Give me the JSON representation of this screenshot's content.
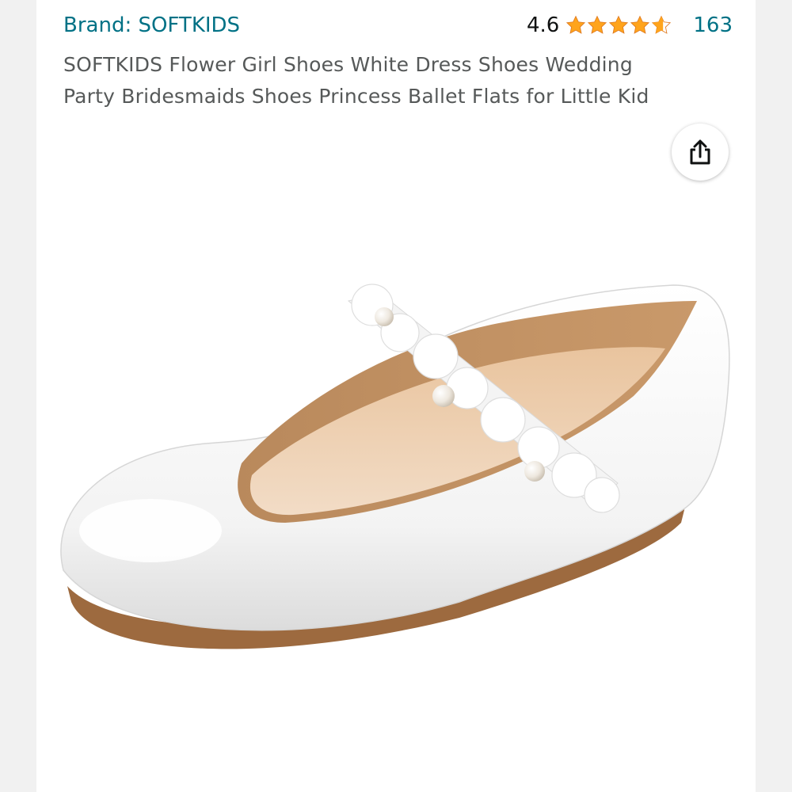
{
  "product": {
    "brand_link": "Brand: SOFTKIDS",
    "title_line1": "SOFTKIDS Flower Girl Shoes White Dress Shoes Wedding",
    "title_line2": "Party Bridesmaids Shoes Princess Ballet Flats for Little Kid",
    "rating_value": "4.6",
    "rating_stars": 4.6,
    "rating_count": "163"
  },
  "icons": {
    "share": "share-icon",
    "star": "star-icon"
  },
  "colors": {
    "link": "#007185",
    "star": "#ffa41c",
    "title": "#565959"
  }
}
